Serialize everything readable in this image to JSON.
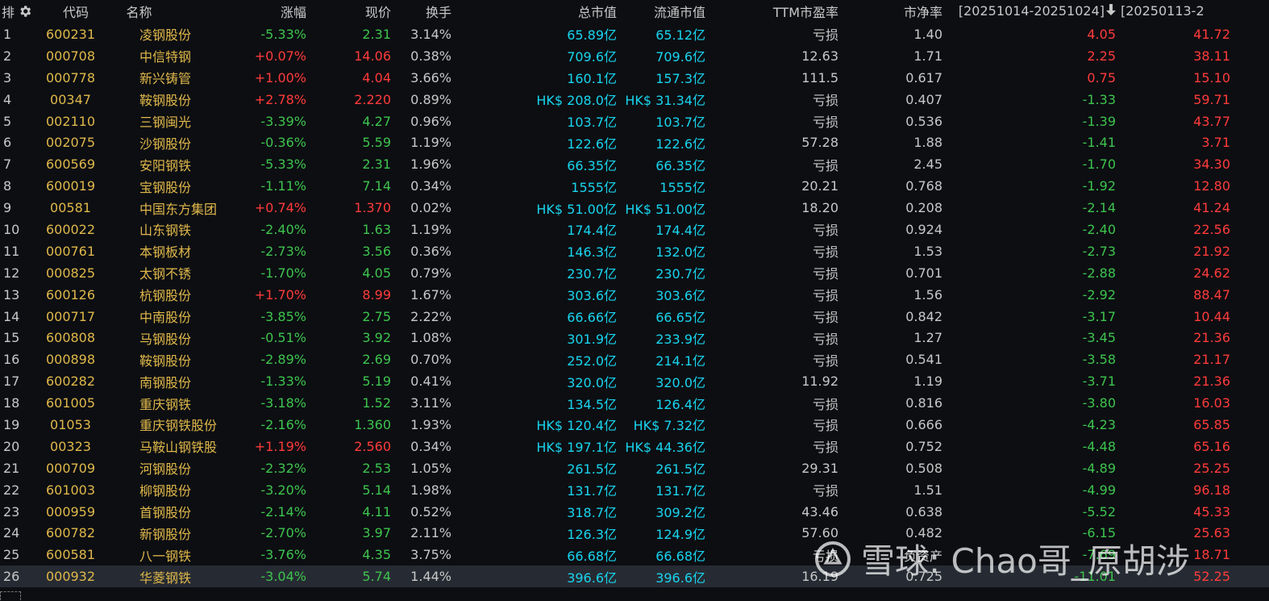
{
  "header": {
    "rank": "排",
    "code": "代码",
    "name": "名称",
    "change_pct": "涨幅",
    "price": "现价",
    "turnover": "换手",
    "total_mv": "总市值",
    "float_mv": "流通市值",
    "pe_ttm": "TTM市盈率",
    "pb": "市净率",
    "range1": "[20251014-20251024]",
    "range2": "[20250113-2"
  },
  "icons": {
    "settings": "gear-icon",
    "sort": "arrow-down-icon"
  },
  "colors": {
    "up": "#ff3b3b",
    "down": "#3ec44e",
    "code": "#e0b84a",
    "value": "#19d4ee",
    "background": "#0c0e12"
  },
  "rows": [
    {
      "idx": "1",
      "code": "600231",
      "name": "凌钢股份",
      "chg": "-5.33%",
      "price": "2.31",
      "turn": "3.14%",
      "tmv": "65.89亿",
      "fmv": "65.12亿",
      "pe": "亏损",
      "pb": "1.40",
      "r1": "4.05",
      "r2": "41.72",
      "dir": "down",
      "r1dir": "up"
    },
    {
      "idx": "2",
      "code": "000708",
      "name": "中信特钢",
      "chg": "+0.07%",
      "price": "14.06",
      "turn": "0.38%",
      "tmv": "709.6亿",
      "fmv": "709.6亿",
      "pe": "12.63",
      "pb": "1.71",
      "r1": "2.25",
      "r2": "38.11",
      "dir": "up",
      "r1dir": "up"
    },
    {
      "idx": "3",
      "code": "000778",
      "name": "新兴铸管",
      "chg": "+1.00%",
      "price": "4.04",
      "turn": "3.66%",
      "tmv": "160.1亿",
      "fmv": "157.3亿",
      "pe": "111.5",
      "pb": "0.617",
      "r1": "0.75",
      "r2": "15.10",
      "dir": "up",
      "r1dir": "up"
    },
    {
      "idx": "4",
      "code": "00347",
      "name": "鞍钢股份",
      "chg": "+2.78%",
      "price": "2.220",
      "turn": "0.89%",
      "tmv": "HK$ 208.0亿",
      "fmv": "HK$ 31.34亿",
      "pe": "亏损",
      "pb": "0.407",
      "r1": "-1.33",
      "r2": "59.71",
      "dir": "up",
      "r1dir": "down"
    },
    {
      "idx": "5",
      "code": "002110",
      "name": "三钢闽光",
      "chg": "-3.39%",
      "price": "4.27",
      "turn": "0.96%",
      "tmv": "103.7亿",
      "fmv": "103.7亿",
      "pe": "亏损",
      "pb": "0.536",
      "r1": "-1.39",
      "r2": "43.77",
      "dir": "down",
      "r1dir": "down"
    },
    {
      "idx": "6",
      "code": "002075",
      "name": "沙钢股份",
      "chg": "-0.36%",
      "price": "5.59",
      "turn": "1.19%",
      "tmv": "122.6亿",
      "fmv": "122.6亿",
      "pe": "57.28",
      "pb": "1.88",
      "r1": "-1.41",
      "r2": "3.71",
      "dir": "down",
      "r1dir": "down"
    },
    {
      "idx": "7",
      "code": "600569",
      "name": "安阳钢铁",
      "chg": "-5.33%",
      "price": "2.31",
      "turn": "1.96%",
      "tmv": "66.35亿",
      "fmv": "66.35亿",
      "pe": "亏损",
      "pb": "2.45",
      "r1": "-1.70",
      "r2": "34.30",
      "dir": "down",
      "r1dir": "down"
    },
    {
      "idx": "8",
      "code": "600019",
      "name": "宝钢股份",
      "chg": "-1.11%",
      "price": "7.14",
      "turn": "0.34%",
      "tmv": "1555亿",
      "fmv": "1555亿",
      "pe": "20.21",
      "pb": "0.768",
      "r1": "-1.92",
      "r2": "12.80",
      "dir": "down",
      "r1dir": "down"
    },
    {
      "idx": "9",
      "code": "00581",
      "name": "中国东方集团",
      "chg": "+0.74%",
      "price": "1.370",
      "turn": "0.02%",
      "tmv": "HK$ 51.00亿",
      "fmv": "HK$ 51.00亿",
      "pe": "18.20",
      "pb": "0.208",
      "r1": "-2.14",
      "r2": "41.24",
      "dir": "up",
      "r1dir": "down"
    },
    {
      "idx": "10",
      "code": "600022",
      "name": "山东钢铁",
      "chg": "-2.40%",
      "price": "1.63",
      "turn": "1.19%",
      "tmv": "174.4亿",
      "fmv": "174.4亿",
      "pe": "亏损",
      "pb": "0.924",
      "r1": "-2.40",
      "r2": "22.56",
      "dir": "down",
      "r1dir": "down"
    },
    {
      "idx": "11",
      "code": "000761",
      "name": "本钢板材",
      "chg": "-2.73%",
      "price": "3.56",
      "turn": "0.36%",
      "tmv": "146.3亿",
      "fmv": "132.0亿",
      "pe": "亏损",
      "pb": "1.53",
      "r1": "-2.73",
      "r2": "21.92",
      "dir": "down",
      "r1dir": "down"
    },
    {
      "idx": "12",
      "code": "000825",
      "name": "太钢不锈",
      "chg": "-1.70%",
      "price": "4.05",
      "turn": "0.79%",
      "tmv": "230.7亿",
      "fmv": "230.7亿",
      "pe": "亏损",
      "pb": "0.701",
      "r1": "-2.88",
      "r2": "24.62",
      "dir": "down",
      "r1dir": "down"
    },
    {
      "idx": "13",
      "code": "600126",
      "name": "杭钢股份",
      "chg": "+1.70%",
      "price": "8.99",
      "turn": "1.67%",
      "tmv": "303.6亿",
      "fmv": "303.6亿",
      "pe": "亏损",
      "pb": "1.56",
      "r1": "-2.92",
      "r2": "88.47",
      "dir": "up",
      "r1dir": "down"
    },
    {
      "idx": "14",
      "code": "000717",
      "name": "中南股份",
      "chg": "-3.85%",
      "price": "2.75",
      "turn": "2.22%",
      "tmv": "66.66亿",
      "fmv": "66.65亿",
      "pe": "亏损",
      "pb": "0.842",
      "r1": "-3.17",
      "r2": "10.44",
      "dir": "down",
      "r1dir": "down"
    },
    {
      "idx": "15",
      "code": "600808",
      "name": "马钢股份",
      "chg": "-0.51%",
      "price": "3.92",
      "turn": "1.08%",
      "tmv": "301.9亿",
      "fmv": "233.9亿",
      "pe": "亏损",
      "pb": "1.27",
      "r1": "-3.45",
      "r2": "21.36",
      "dir": "down",
      "r1dir": "down"
    },
    {
      "idx": "16",
      "code": "000898",
      "name": "鞍钢股份",
      "chg": "-2.89%",
      "price": "2.69",
      "turn": "0.70%",
      "tmv": "252.0亿",
      "fmv": "214.1亿",
      "pe": "亏损",
      "pb": "0.541",
      "r1": "-3.58",
      "r2": "21.17",
      "dir": "down",
      "r1dir": "down"
    },
    {
      "idx": "17",
      "code": "600282",
      "name": "南钢股份",
      "chg": "-1.33%",
      "price": "5.19",
      "turn": "0.41%",
      "tmv": "320.0亿",
      "fmv": "320.0亿",
      "pe": "11.92",
      "pb": "1.19",
      "r1": "-3.71",
      "r2": "21.36",
      "dir": "down",
      "r1dir": "down"
    },
    {
      "idx": "18",
      "code": "601005",
      "name": "重庆钢铁",
      "chg": "-3.18%",
      "price": "1.52",
      "turn": "3.11%",
      "tmv": "134.5亿",
      "fmv": "126.4亿",
      "pe": "亏损",
      "pb": "0.816",
      "r1": "-3.80",
      "r2": "16.03",
      "dir": "down",
      "r1dir": "down"
    },
    {
      "idx": "19",
      "code": "01053",
      "name": "重庆钢铁股份",
      "chg": "-2.16%",
      "price": "1.360",
      "turn": "1.93%",
      "tmv": "HK$ 120.4亿",
      "fmv": "HK$ 7.32亿",
      "pe": "亏损",
      "pb": "0.666",
      "r1": "-4.23",
      "r2": "65.85",
      "dir": "down",
      "r1dir": "down"
    },
    {
      "idx": "20",
      "code": "00323",
      "name": "马鞍山钢铁股份",
      "chg": "+1.19%",
      "price": "2.560",
      "turn": "0.34%",
      "tmv": "HK$ 197.1亿",
      "fmv": "HK$ 44.36亿",
      "pe": "亏损",
      "pb": "0.752",
      "r1": "-4.48",
      "r2": "65.16",
      "dir": "up",
      "r1dir": "down"
    },
    {
      "idx": "21",
      "code": "000709",
      "name": "河钢股份",
      "chg": "-2.32%",
      "price": "2.53",
      "turn": "1.05%",
      "tmv": "261.5亿",
      "fmv": "261.5亿",
      "pe": "29.31",
      "pb": "0.508",
      "r1": "-4.89",
      "r2": "25.25",
      "dir": "down",
      "r1dir": "down"
    },
    {
      "idx": "22",
      "code": "601003",
      "name": "柳钢股份",
      "chg": "-3.20%",
      "price": "5.14",
      "turn": "1.98%",
      "tmv": "131.7亿",
      "fmv": "131.7亿",
      "pe": "亏损",
      "pb": "1.51",
      "r1": "-4.99",
      "r2": "96.18",
      "dir": "down",
      "r1dir": "down"
    },
    {
      "idx": "23",
      "code": "000959",
      "name": "首钢股份",
      "chg": "-2.14%",
      "price": "4.11",
      "turn": "0.52%",
      "tmv": "318.7亿",
      "fmv": "309.2亿",
      "pe": "43.46",
      "pb": "0.638",
      "r1": "-5.52",
      "r2": "45.33",
      "dir": "down",
      "r1dir": "down"
    },
    {
      "idx": "24",
      "code": "600782",
      "name": "新钢股份",
      "chg": "-2.70%",
      "price": "3.97",
      "turn": "2.11%",
      "tmv": "126.3亿",
      "fmv": "124.9亿",
      "pe": "57.60",
      "pb": "0.482",
      "r1": "-6.15",
      "r2": "25.63",
      "dir": "down",
      "r1dir": "down"
    },
    {
      "idx": "25",
      "code": "600581",
      "name": "八一钢铁",
      "chg": "-3.76%",
      "price": "4.35",
      "turn": "3.75%",
      "tmv": "66.68亿",
      "fmv": "66.68亿",
      "pe": "亏损",
      "pb": "负资产",
      "r1": "-7.69",
      "r2": "18.71",
      "dir": "down",
      "r1dir": "down"
    },
    {
      "idx": "26",
      "code": "000932",
      "name": "华菱钢铁",
      "chg": "-3.04%",
      "price": "5.74",
      "turn": "1.44%",
      "tmv": "396.6亿",
      "fmv": "396.6亿",
      "pe": "16.19",
      "pb": "0.725",
      "r1": "-11.01",
      "r2": "52.25",
      "dir": "down",
      "r1dir": "down"
    }
  ],
  "watermark": {
    "text": "雪球: Chao哥_原胡涉",
    "logo": "snowball-logo-icon"
  }
}
